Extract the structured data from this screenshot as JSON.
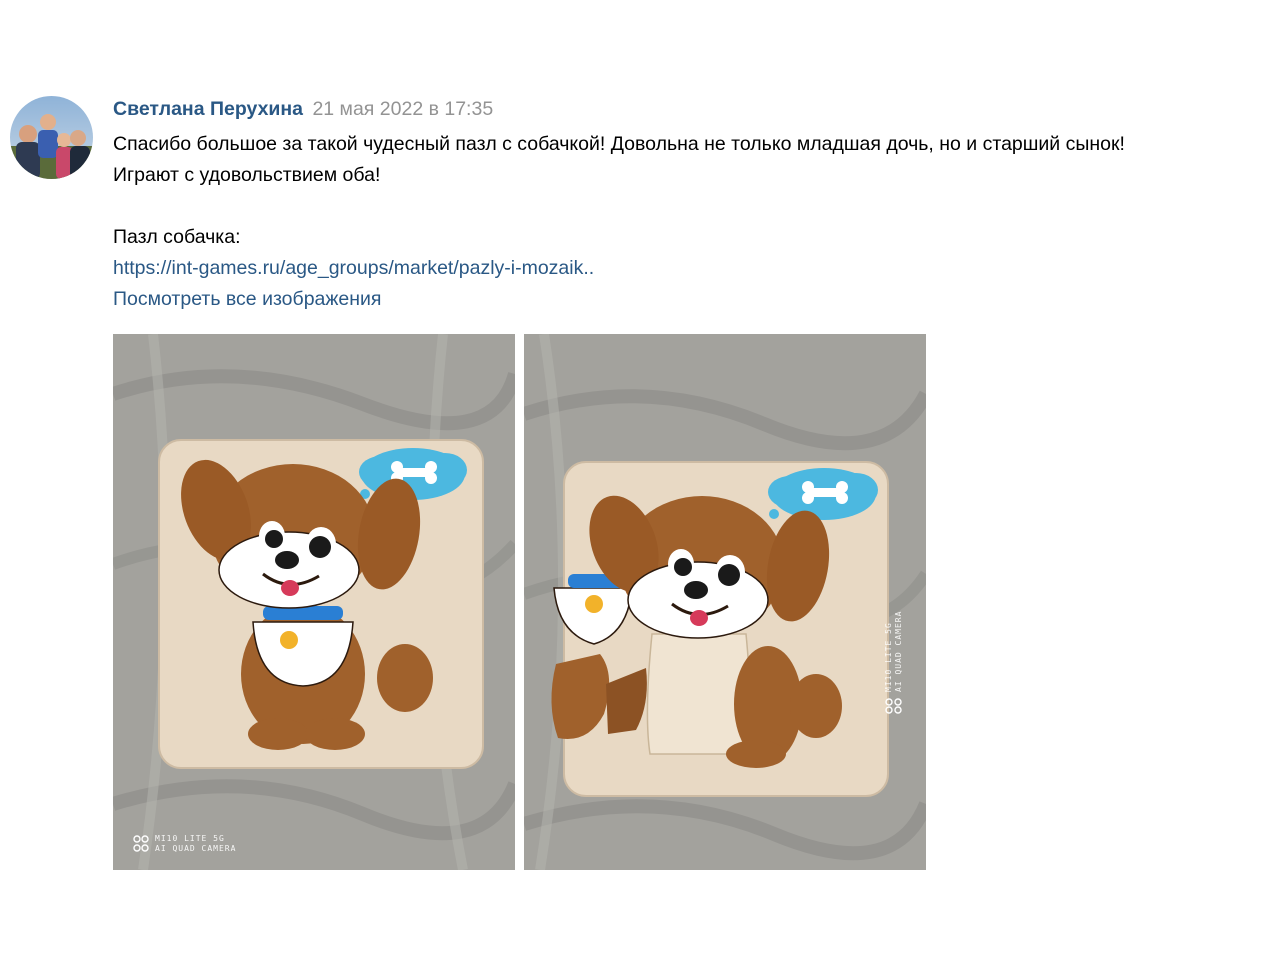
{
  "post": {
    "author": "Светлана Перухина",
    "date": "21 мая 2022 в 17:35",
    "text_lines": [
      "Спасибо большое за такой чудесный пазл с собачкой! Довольна не только младшая дочь, но и старший сынок!",
      "Играют с удовольствием оба!"
    ],
    "product_label": "Пазл собачка:",
    "product_link": "https://int-games.ru/age_groups/market/pazly-i-mozaik..",
    "view_all_images": "Посмотреть все изображения",
    "photos": [
      {
        "watermark_line1": "MI10 LITE 5G",
        "watermark_line2": "AI QUAD CAMERA"
      },
      {
        "watermark_line1": "MI10 LITE 5G",
        "watermark_line2": "AI QUAD CAMERA"
      }
    ]
  },
  "colors": {
    "link": "#2a5885",
    "date": "#939393",
    "text": "#000000"
  }
}
